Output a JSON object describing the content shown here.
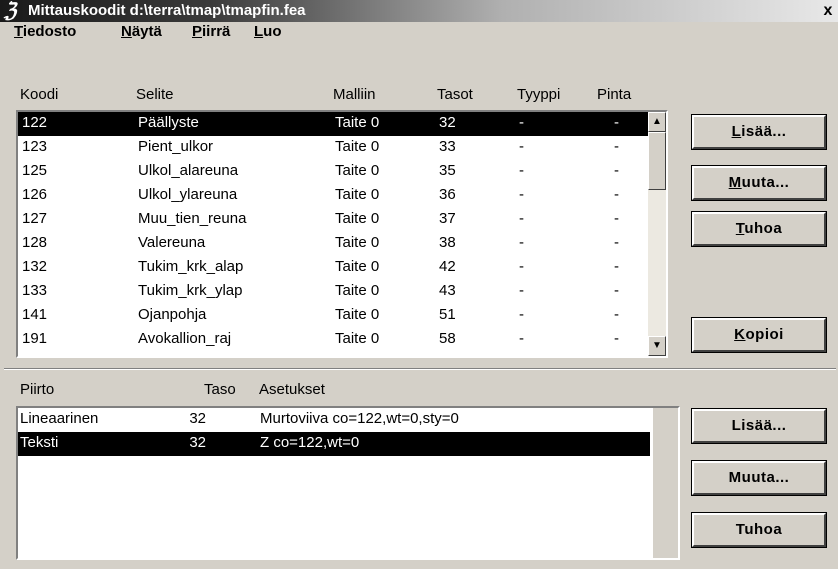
{
  "window": {
    "title": "Mittauskoodit d:\\terra\\tmap\\tmapfin.fea",
    "app_icon": "app-logo-icon",
    "close_glyph": "x"
  },
  "menu": [
    {
      "accel": "T",
      "rest": "iedosto"
    },
    {
      "accel": "N",
      "rest": "äytä"
    },
    {
      "accel": "P",
      "rest": "iirrä"
    },
    {
      "accel": "L",
      "rest": "uo"
    }
  ],
  "codes": {
    "headers": [
      "Koodi",
      "Selite",
      "Malliin",
      "Tasot",
      "Tyyppi",
      "Pinta"
    ],
    "rows": [
      [
        "122",
        "Päällyste",
        "Taite 0",
        "32",
        "-",
        "-"
      ],
      [
        "123",
        "Pient_ulkor",
        "Taite 0",
        "33",
        "-",
        "-"
      ],
      [
        "125",
        "Ulkol_alareuna",
        "Taite 0",
        "35",
        "-",
        "-"
      ],
      [
        "126",
        "Ulkol_ylareuna",
        "Taite 0",
        "36",
        "-",
        "-"
      ],
      [
        "127",
        "Muu_tien_reuna",
        "Taite 0",
        "37",
        "-",
        "-"
      ],
      [
        "128",
        "Valereuna",
        "Taite 0",
        "38",
        "-",
        "-"
      ],
      [
        "132",
        "Tukim_krk_alap",
        "Taite 0",
        "42",
        "-",
        "-"
      ],
      [
        "133",
        "Tukim_krk_ylap",
        "Taite 0",
        "43",
        "-",
        "-"
      ],
      [
        "141",
        "Ojanpohja",
        "Taite 0",
        "51",
        "-",
        "-"
      ],
      [
        "191",
        "Avokallion_raj",
        "Taite 0",
        "58",
        "-",
        "-"
      ]
    ],
    "selected_index": 0,
    "buttons": [
      {
        "accel": "L",
        "rest": "isää..."
      },
      {
        "accel": "M",
        "rest": "uuta..."
      },
      {
        "accel": "T",
        "rest": "uhoa"
      },
      {
        "accel": "K",
        "rest": "opioi"
      }
    ]
  },
  "drawing": {
    "headers": [
      "Piirto",
      "Taso",
      "Asetukset"
    ],
    "rows": [
      [
        "Lineaarinen",
        "32",
        "Murtoviiva  co=122,wt=0,sty=0"
      ],
      [
        "Teksti",
        "32",
        "Z  co=122,wt=0"
      ]
    ],
    "selected_index": 1,
    "buttons": [
      "Lisää...",
      "Muuta...",
      "Tuhoa"
    ]
  }
}
